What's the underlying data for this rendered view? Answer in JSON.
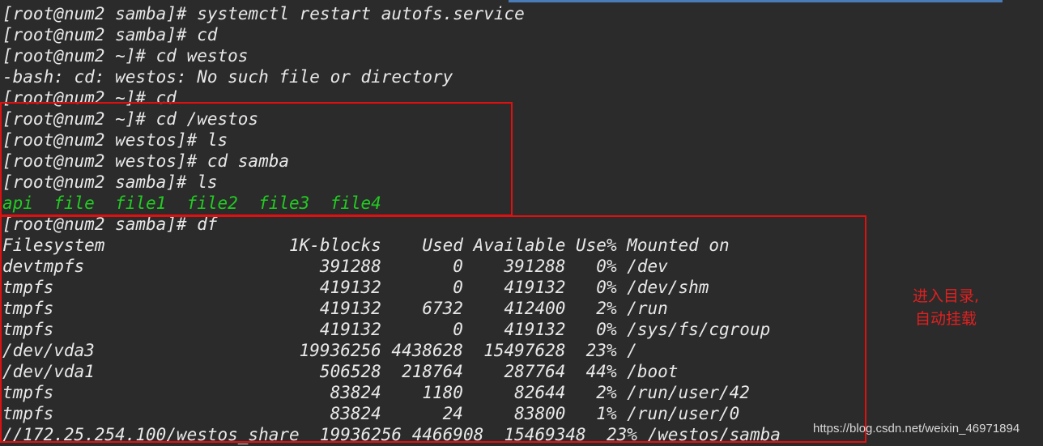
{
  "terminal": {
    "lines": [
      {
        "text": "[root@num2 samba]# systemctl restart autofs.service",
        "color": "default"
      },
      {
        "text": "[root@num2 samba]# cd",
        "color": "default"
      },
      {
        "text": "[root@num2 ~]# cd westos",
        "color": "default"
      },
      {
        "text": "-bash: cd: westos: No such file or directory",
        "color": "default"
      },
      {
        "text": "[root@num2 ~]# cd",
        "color": "default"
      },
      {
        "text": "[root@num2 ~]# cd /westos",
        "color": "default"
      },
      {
        "text": "[root@num2 westos]# ls",
        "color": "default"
      },
      {
        "text": "[root@num2 westos]# cd samba",
        "color": "default"
      },
      {
        "text": "[root@num2 samba]# ls",
        "color": "default"
      },
      {
        "text": "api  file  file1  file2  file3  file4",
        "color": "green"
      },
      {
        "text": "[root@num2 samba]# df",
        "color": "default"
      },
      {
        "text": "Filesystem                  1K-blocks    Used Available Use% Mounted on",
        "color": "default"
      },
      {
        "text": "devtmpfs                       391288       0    391288   0% /dev",
        "color": "default"
      },
      {
        "text": "tmpfs                          419132       0    419132   0% /dev/shm",
        "color": "default"
      },
      {
        "text": "tmpfs                          419132    6732    412400   2% /run",
        "color": "default"
      },
      {
        "text": "tmpfs                          419132       0    419132   0% /sys/fs/cgroup",
        "color": "default"
      },
      {
        "text": "/dev/vda3                    19936256 4438628  15497628  23% /",
        "color": "default"
      },
      {
        "text": "/dev/vda1                      506528  218764    287764  44% /boot",
        "color": "default"
      },
      {
        "text": "tmpfs                           83824    1180     82644   2% /run/user/42",
        "color": "default"
      },
      {
        "text": "tmpfs                           83824      24     83800   1% /run/user/0",
        "color": "default"
      },
      {
        "text": "//172.25.254.100/westos_share  19936256 4466908  15469348  23% /westos/samba",
        "color": "default"
      }
    ]
  },
  "annotation": {
    "line1": "进入目录,",
    "line2": "自动挂载"
  },
  "watermark": "https://blog.csdn.net/weixin_46971894",
  "colors": {
    "background": "#2b2b2b",
    "text": "#e8e8e8",
    "green_text": "#22cc22",
    "highlight": "#e01010"
  }
}
